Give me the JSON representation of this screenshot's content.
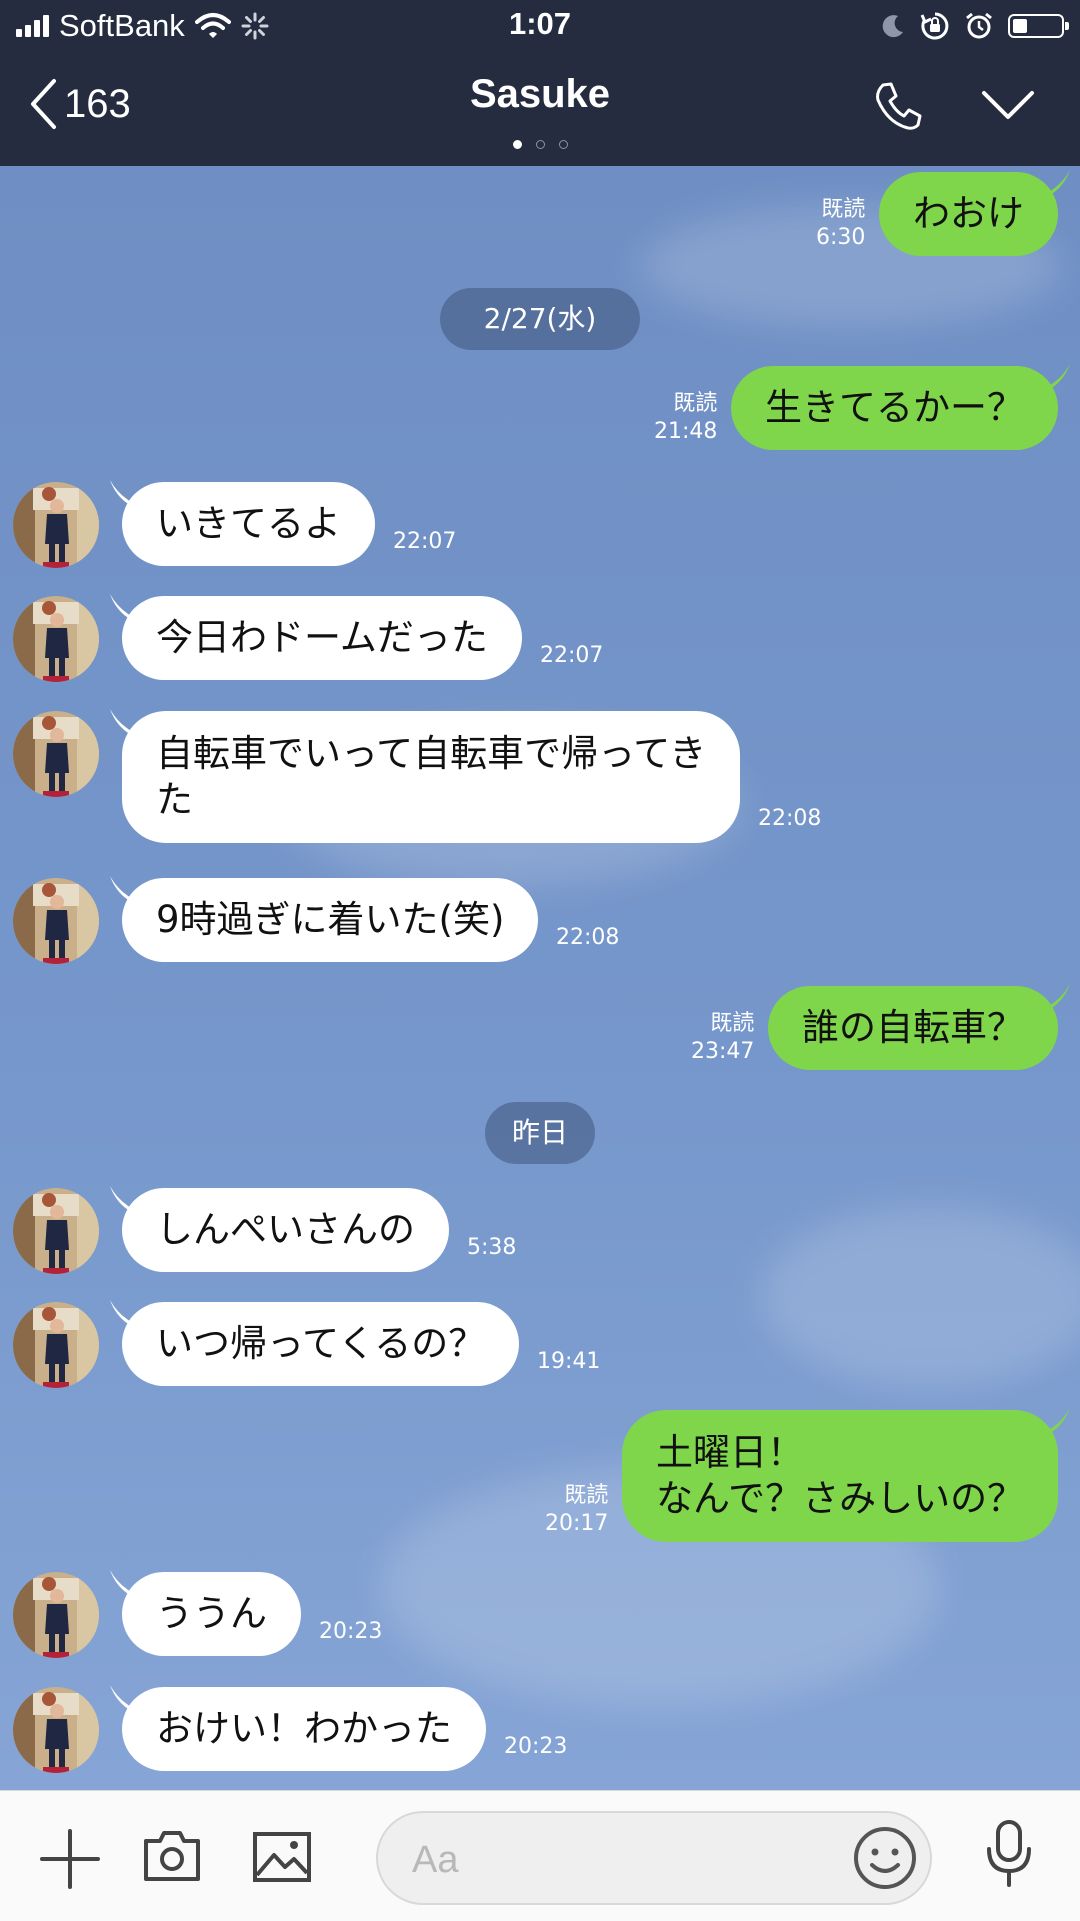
{
  "status_bar": {
    "carrier": "SoftBank",
    "time": "1:07",
    "battery_level": 0.3,
    "icons": [
      "signal-icon",
      "wifi-icon",
      "loading-icon",
      "moon-icon",
      "rotation-lock-icon",
      "alarm-icon",
      "battery-icon"
    ]
  },
  "header": {
    "back_count": "163",
    "title": "Sasuke",
    "page_count": 3,
    "active_page": 1,
    "icons": [
      "back-chevron-icon",
      "phone-icon",
      "chevron-down-icon"
    ]
  },
  "colors": {
    "bar": "#252c3f",
    "chat_bg": "#7493c8",
    "outgoing_bubble": "#7fd64a",
    "incoming_bubble": "#ffffff"
  },
  "messages": [
    {
      "dir": "out",
      "lines": [
        "わおけ"
      ],
      "read": "既読",
      "time": "6:30"
    },
    {
      "dir": "date",
      "label": "2/27(水)"
    },
    {
      "dir": "out",
      "lines": [
        "生きてるかー？"
      ],
      "read": "既読",
      "time": "21:48"
    },
    {
      "dir": "in",
      "lines": [
        "いきてるよ"
      ],
      "time": "22:07"
    },
    {
      "dir": "in",
      "lines": [
        "今日わドームだった"
      ],
      "time": "22:07"
    },
    {
      "dir": "in",
      "lines": [
        "自転車でいって自転車で帰ってき",
        "た"
      ],
      "time": "22:08"
    },
    {
      "dir": "in",
      "lines": [
        "9時過ぎに着いた(笑)"
      ],
      "time": "22:08"
    },
    {
      "dir": "out",
      "lines": [
        "誰の自転車？"
      ],
      "read": "既読",
      "time": "23:47"
    },
    {
      "dir": "date",
      "label": "昨日"
    },
    {
      "dir": "in",
      "lines": [
        "しんぺいさんの"
      ],
      "time": "5:38"
    },
    {
      "dir": "in",
      "lines": [
        "いつ帰ってくるの？"
      ],
      "time": "19:41"
    },
    {
      "dir": "out",
      "lines": [
        "土曜日！",
        "なんで？さみしいの？"
      ],
      "read": "既読",
      "time": "20:17"
    },
    {
      "dir": "in",
      "lines": [
        "ううん"
      ],
      "time": "20:23"
    },
    {
      "dir": "in",
      "lines": [
        "おけい！わかった"
      ],
      "time": "20:23"
    }
  ],
  "input_bar": {
    "placeholder": "Aa",
    "value": "",
    "icons": [
      "plus-icon",
      "camera-icon",
      "image-icon",
      "emoji-icon",
      "microphone-icon"
    ]
  }
}
